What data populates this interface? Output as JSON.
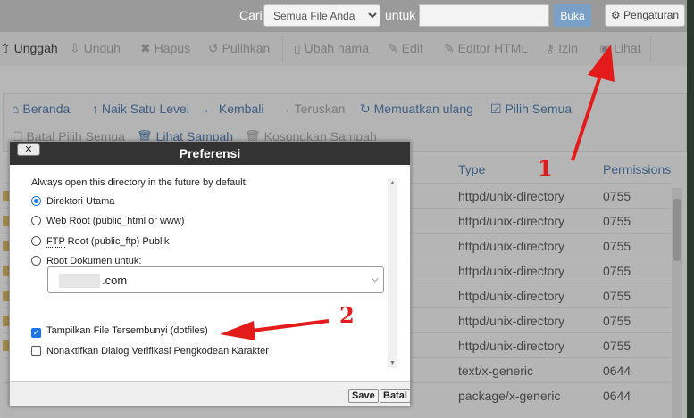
{
  "search": {
    "cari_label": "Cari",
    "scope_value": "Semua File Anda",
    "untuk_label": "untuk",
    "input_value": "",
    "buka_label": "Buka",
    "settings_label": "Pengaturan"
  },
  "toolbar": {
    "items": [
      "Unggah",
      "Unduh",
      "Hapus",
      "Pulihkan",
      "Ubah nama",
      "Edit",
      "Editor HTML",
      "Izin",
      "Lihat"
    ]
  },
  "nav": {
    "items": [
      "Beranda",
      "Naik Satu Level",
      "Kembali",
      "Teruskan",
      "Memuatkan ulang",
      "Pilih Semua",
      "Batal Pilih Semua",
      "Lihat Sampah",
      "Kosongkan Sampah"
    ]
  },
  "table": {
    "headers": {
      "type": "Type",
      "permissions": "Permissions"
    },
    "rows": [
      {
        "type": "httpd/unix-directory",
        "perm": "0755"
      },
      {
        "type": "httpd/unix-directory",
        "perm": "0755"
      },
      {
        "type": "httpd/unix-directory",
        "perm": "0755"
      },
      {
        "type": "httpd/unix-directory",
        "perm": "0755"
      },
      {
        "type": "httpd/unix-directory",
        "perm": "0755"
      },
      {
        "type": "httpd/unix-directory",
        "perm": "0755"
      },
      {
        "type": "httpd/unix-directory",
        "perm": "0755"
      },
      {
        "type": "text/x-generic",
        "perm": "0644"
      },
      {
        "type": "package/x-generic",
        "perm": "0644"
      }
    ]
  },
  "dialog": {
    "title": "Preferensi",
    "intro": "Always open this directory in the future by default:",
    "options": {
      "home": "Direktori Utama",
      "webroot": "Web Root (public_html or www)",
      "ftp_abbr": "FTP",
      "ftp_rest": " Root (public_ftp) Publik",
      "docroot": "Root Dokumen untuk:"
    },
    "selected_option": "home",
    "domain_value": ".com",
    "show_hidden_label": "Tampilkan File Tersembunyi (dotfiles)",
    "show_hidden_checked": true,
    "disable_encoding_label": "Nonaktifkan Dialog Verifikasi Pengkodean Karakter",
    "disable_encoding_checked": false,
    "save_label": "Save",
    "cancel_label": "Batal"
  },
  "annotations": {
    "one": "1",
    "two": "2",
    "color": "#e41b1b"
  },
  "colors": {
    "link": "#3d5f84",
    "dialog_header": "#333333",
    "accent": "#1a73e8"
  }
}
